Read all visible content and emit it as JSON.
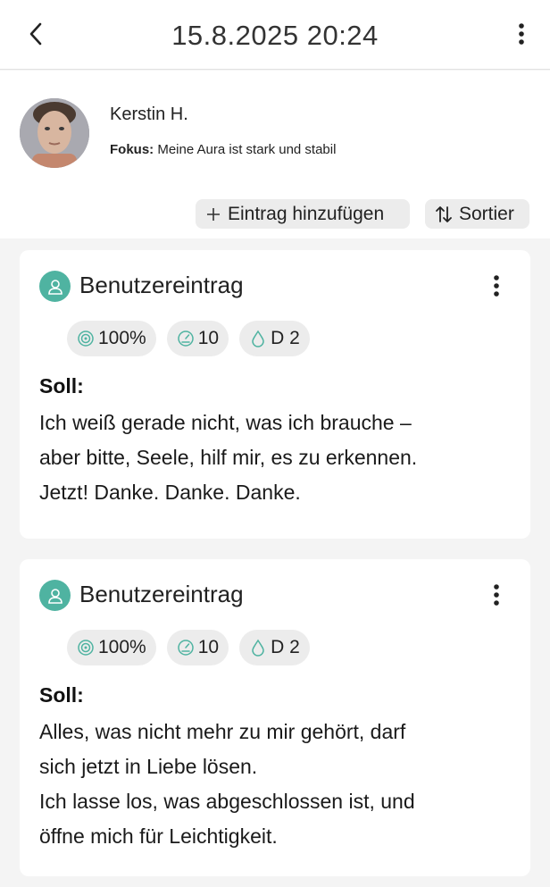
{
  "header": {
    "title": "15.8.2025 20:24",
    "back_icon": "chevron-left-icon",
    "menu_icon": "more-vertical-icon"
  },
  "profile": {
    "name": "Kerstin H.",
    "focus_label": "Fokus:",
    "focus_value": "Meine Aura ist stark und stabil"
  },
  "actions": {
    "add_label": "Eintrag hinzufügen",
    "add_icon": "plus-icon",
    "sort_label": "Sortier",
    "sort_icon": "sort-arrows-icon"
  },
  "entries": [
    {
      "title": "Benutzereintrag",
      "badges": {
        "progress": "100%",
        "level": "10",
        "day": "D 2"
      },
      "section_label": "Soll:",
      "lines": [
        "Ich weiß gerade nicht, was ich brauche –",
        "aber bitte, Seele, hilf mir, es zu erkennen.",
        "Jetzt! Danke. Danke. Danke."
      ]
    },
    {
      "title": "Benutzereintrag",
      "badges": {
        "progress": "100%",
        "level": "10",
        "day": "D 2"
      },
      "section_label": "Soll:",
      "lines": [
        "Alles, was nicht mehr zu mir gehört, darf",
        "sich jetzt in Liebe lösen.",
        "Ich lasse los, was abgeschlossen ist, und",
        "öffne mich für Leichtigkeit."
      ]
    }
  ],
  "colors": {
    "accent": "#4fb3a1",
    "background": "#f4f4f4",
    "chip": "#ececec"
  }
}
